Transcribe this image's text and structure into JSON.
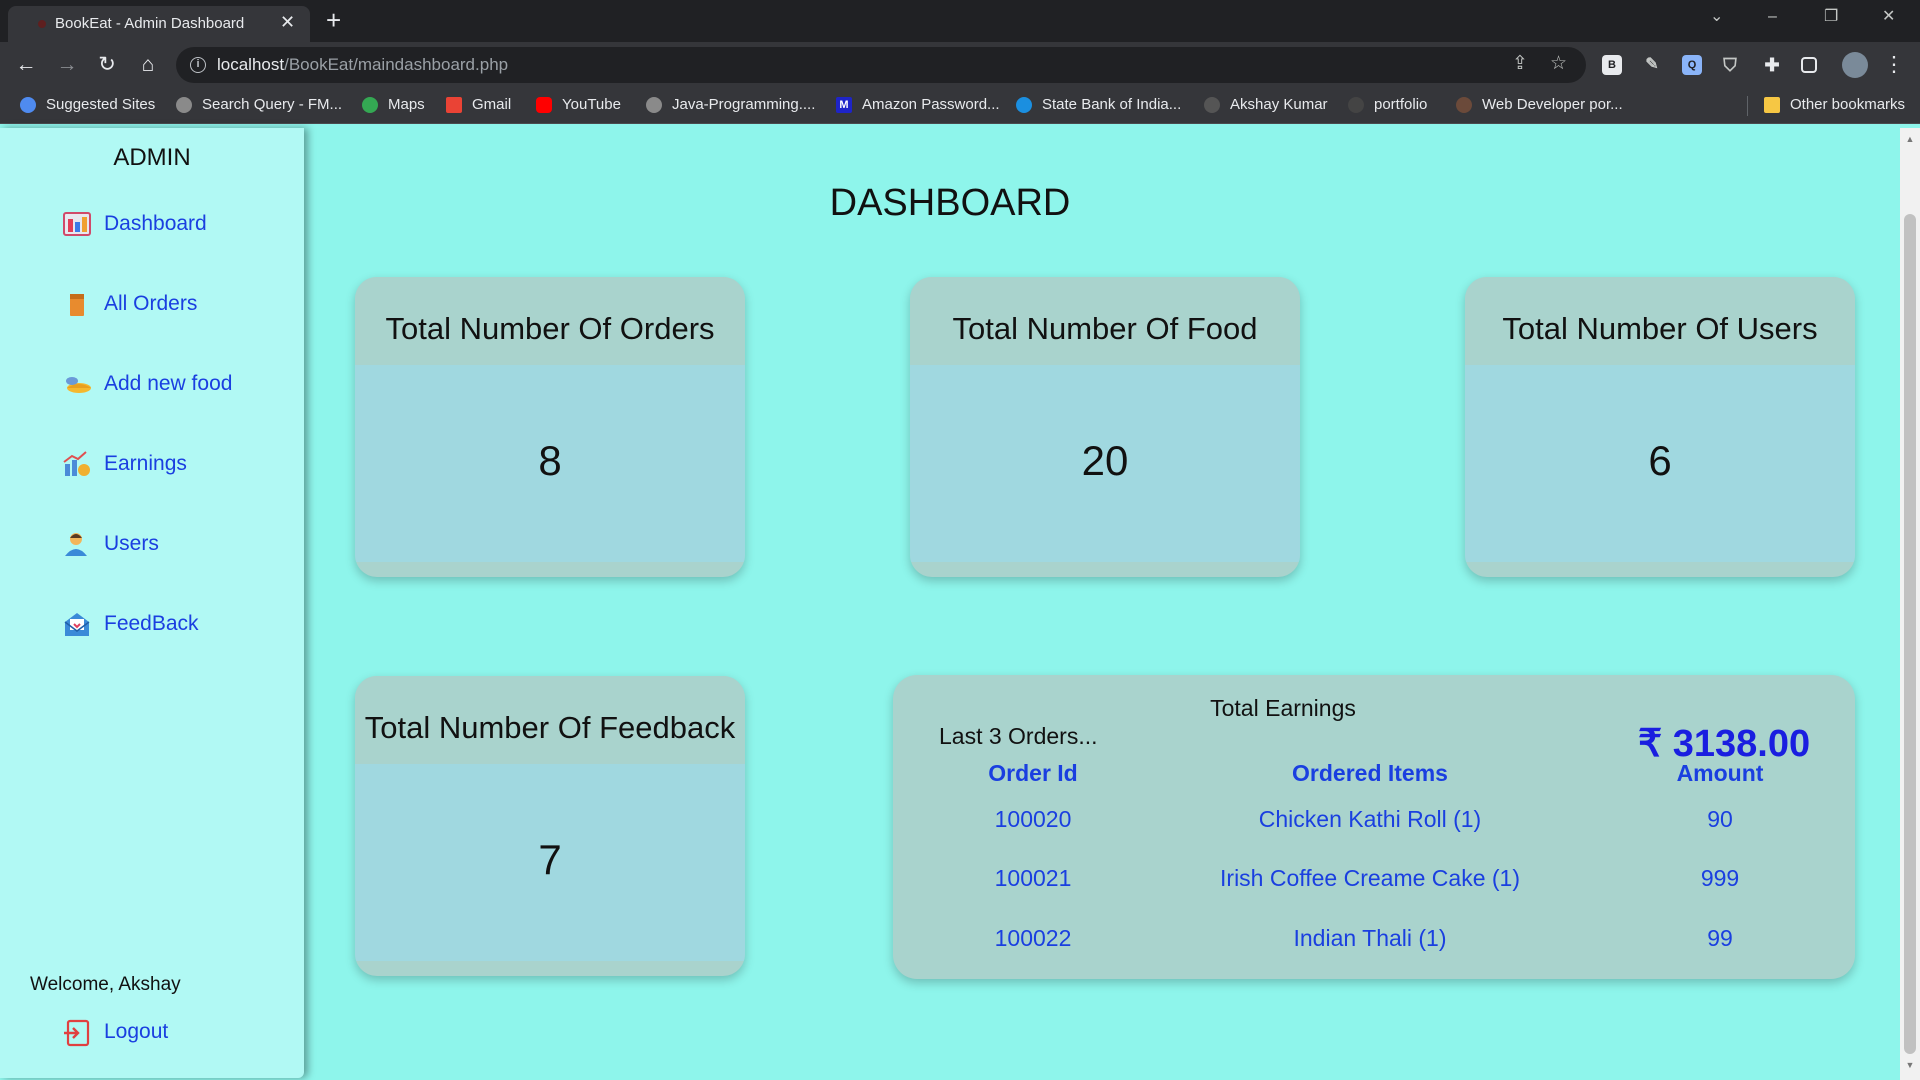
{
  "browser": {
    "tab_title": "BookEat - Admin Dashboard",
    "url_host": "localhost",
    "url_path": "/BookEat/maindashboard.php",
    "ext_b_label": "B",
    "bookmarks": [
      {
        "label": "Suggested Sites",
        "color": "#4f8bf0"
      },
      {
        "label": "Search Query - FM...",
        "color": "#8a8a8a"
      },
      {
        "label": "Maps",
        "color": "#34a853"
      },
      {
        "label": "Gmail",
        "color": "#ea4335"
      },
      {
        "label": "YouTube",
        "color": "#ff0000"
      },
      {
        "label": "Java-Programming....",
        "color": "#8a8a8a"
      },
      {
        "label": "Amazon Password...",
        "color": "#1e24c8"
      },
      {
        "label": "State Bank of India...",
        "color": "#1b8fe0"
      },
      {
        "label": "Akshay Kumar",
        "color": "#555555"
      },
      {
        "label": "portfolio",
        "color": "#444444"
      },
      {
        "label": "Web Developer por...",
        "color": "#6b4a3a"
      }
    ],
    "other_bookmarks": "Other bookmarks"
  },
  "sidebar": {
    "title": "ADMIN",
    "items": [
      {
        "label": "Dashboard",
        "icon": "dashboard-icon"
      },
      {
        "label": "All Orders",
        "icon": "orders-icon"
      },
      {
        "label": "Add new food",
        "icon": "food-icon"
      },
      {
        "label": "Earnings",
        "icon": "earnings-icon"
      },
      {
        "label": "Users",
        "icon": "users-icon"
      },
      {
        "label": "FeedBack",
        "icon": "feedback-icon"
      }
    ],
    "welcome": "Welcome, Akshay",
    "logout": "Logout"
  },
  "main": {
    "title": "DASHBOARD",
    "cards": [
      {
        "title": "Total Number Of Orders",
        "value": "8"
      },
      {
        "title": "Total Number Of Food",
        "value": "20"
      },
      {
        "title": "Total Number Of Users",
        "value": "6"
      },
      {
        "title": "Total Number Of Feedback",
        "value": "7"
      }
    ],
    "earnings": {
      "title": "Total Earnings",
      "total": "₹ 3138.00",
      "last_orders_label": "Last 3 Orders...",
      "columns": [
        "Order Id",
        "Ordered Items",
        "Amount"
      ],
      "rows": [
        {
          "id": "100020",
          "items": "Chicken Kathi Roll (1)",
          "amount": "90"
        },
        {
          "id": "100021",
          "items": "Irish Coffee Creame Cake (1)",
          "amount": "999"
        },
        {
          "id": "100022",
          "items": "Indian Thali (1)",
          "amount": "99"
        }
      ]
    }
  },
  "colors": {
    "page_bg": "#8ef5eb",
    "sidebar_bg": "#b1f9f4",
    "link_blue": "#1a3fe0",
    "card_bg": "#a9d3cd",
    "card_body_bg": "#a0d8e0"
  }
}
